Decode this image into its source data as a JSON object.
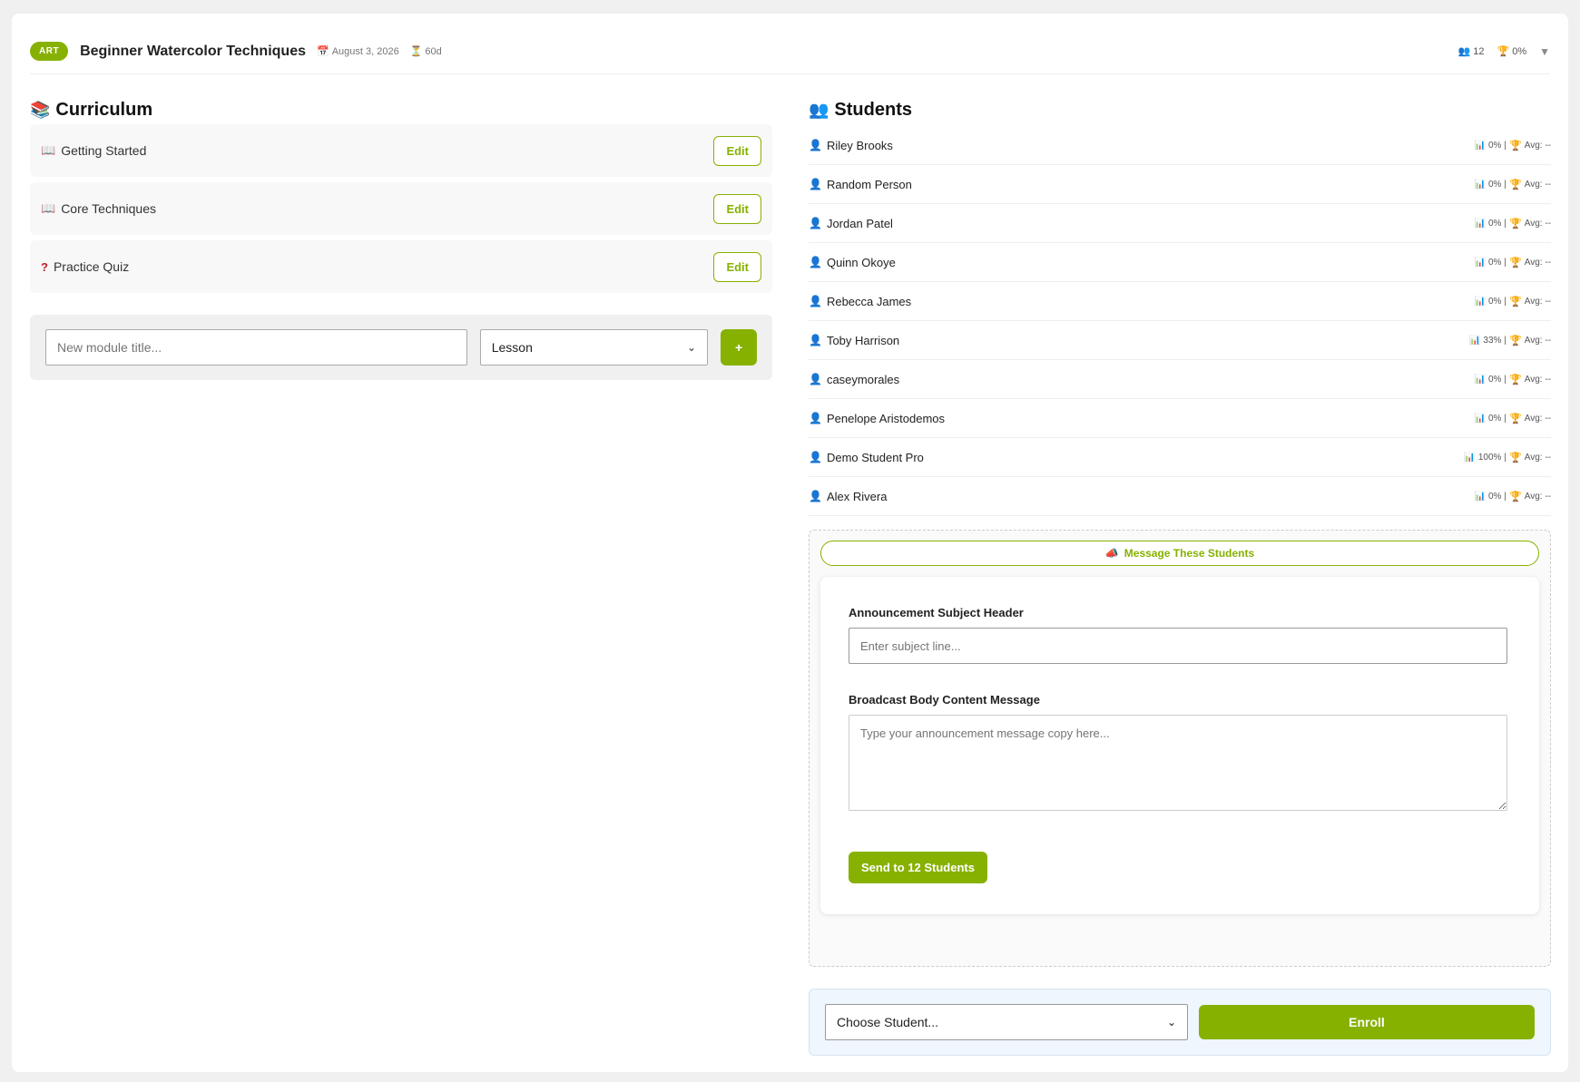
{
  "header": {
    "badge": "ART",
    "title": "Beginner Watercolor Techniques",
    "date": "August 3, 2026",
    "duration": "60d",
    "student_count": "12",
    "completion": "0%"
  },
  "curriculum": {
    "title": "Curriculum",
    "modules": [
      {
        "label": "Getting Started",
        "type": "lesson",
        "edit": "Edit"
      },
      {
        "label": "Core Techniques",
        "type": "lesson",
        "edit": "Edit"
      },
      {
        "label": "Practice Quiz",
        "type": "quiz",
        "edit": "Edit"
      }
    ],
    "new_module_placeholder": "New module title...",
    "new_module_type": "Lesson",
    "add_label": "+"
  },
  "students": {
    "title": "Students",
    "list": [
      {
        "name": "Riley Brooks",
        "progress": "0%",
        "avg": "Avg: --"
      },
      {
        "name": "Random Person",
        "progress": "0%",
        "avg": "Avg: --"
      },
      {
        "name": "Jordan Patel",
        "progress": "0%",
        "avg": "Avg: --"
      },
      {
        "name": "Quinn Okoye",
        "progress": "0%",
        "avg": "Avg: --"
      },
      {
        "name": "Rebecca James",
        "progress": "0%",
        "avg": "Avg: --"
      },
      {
        "name": "Toby Harrison",
        "progress": "33%",
        "avg": "Avg: --"
      },
      {
        "name": "caseymorales",
        "progress": "0%",
        "avg": "Avg: --"
      },
      {
        "name": "Penelope Aristodemos",
        "progress": "0%",
        "avg": "Avg: --"
      },
      {
        "name": "Demo Student Pro",
        "progress": "100%",
        "avg": "Avg: --"
      },
      {
        "name": "Alex Rivera",
        "progress": "0%",
        "avg": "Avg: --"
      }
    ]
  },
  "broadcast": {
    "toggle_label": "Message These Students",
    "subject_label": "Announcement Subject Header",
    "subject_placeholder": "Enter subject line...",
    "body_label": "Broadcast Body Content Message",
    "body_placeholder": "Type your announcement message copy here...",
    "send_label": "Send to 12 Students"
  },
  "enroll": {
    "select_value": "Choose Student...",
    "button_label": "Enroll"
  },
  "colors": {
    "accent": "#86b100"
  }
}
